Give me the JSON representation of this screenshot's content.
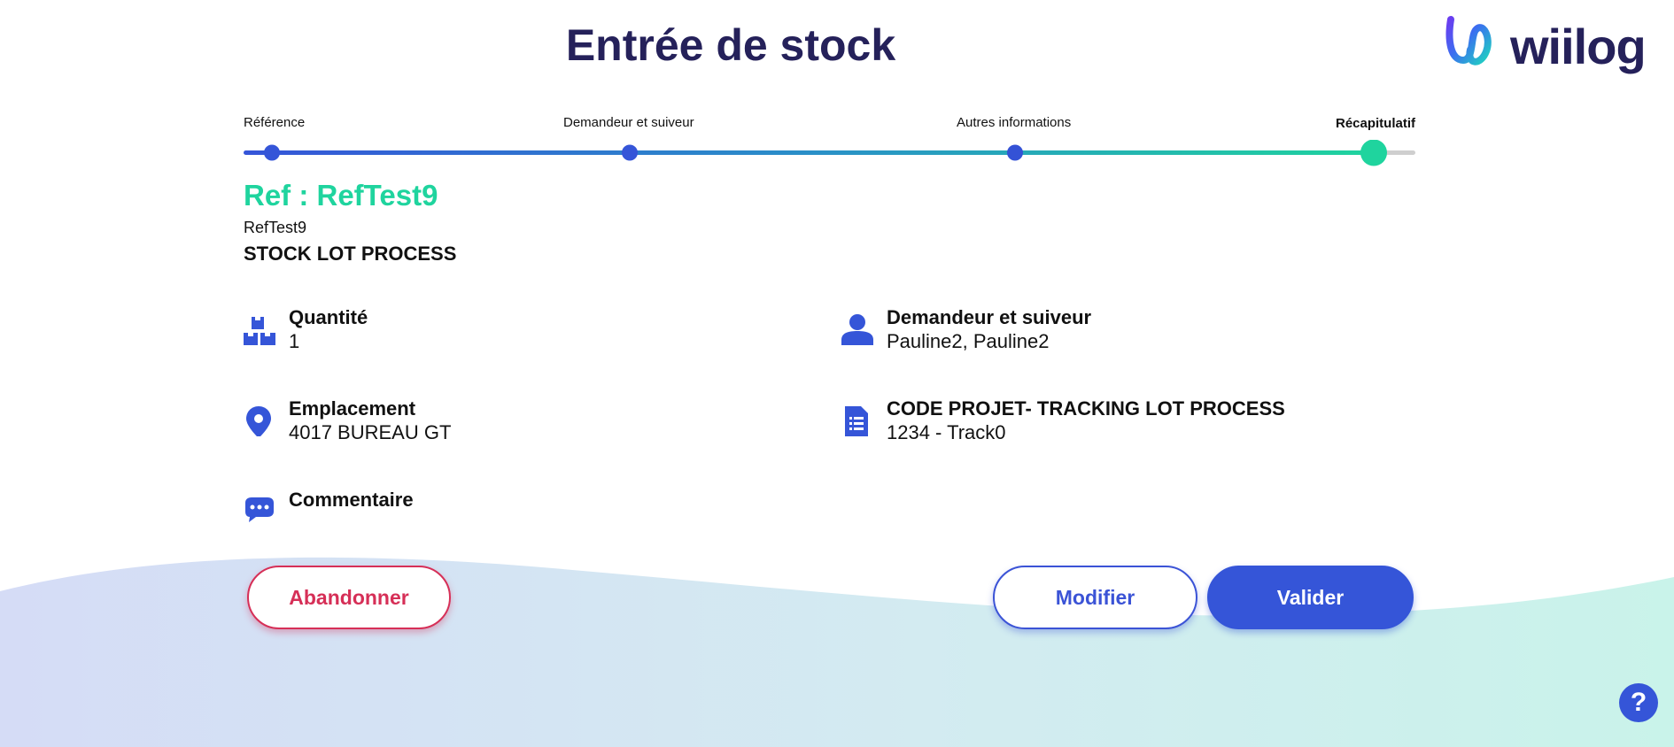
{
  "header": {
    "title": "Entrée de stock",
    "logo_text": "wiilog"
  },
  "stepper": {
    "steps": [
      {
        "label": "Référence"
      },
      {
        "label": "Demandeur et suiveur"
      },
      {
        "label": "Autres informations"
      },
      {
        "label": "Récapitulatif",
        "active": true
      }
    ]
  },
  "reference": {
    "title": "Ref : RefTest9",
    "code": "RefTest9",
    "description": "STOCK LOT PROCESS"
  },
  "details": {
    "quantity": {
      "label": "Quantité",
      "value": "1",
      "icon": "boxes-icon"
    },
    "requester": {
      "label": "Demandeur et suiveur",
      "value": "Pauline2, Pauline2",
      "icon": "user-icon"
    },
    "location": {
      "label": "Emplacement",
      "value": "4017 BUREAU GT",
      "icon": "location-pin-icon"
    },
    "project": {
      "label": "CODE PROJET- TRACKING LOT PROCESS",
      "value": "1234 - Track0",
      "icon": "document-icon"
    },
    "comment": {
      "label": "Commentaire",
      "icon": "comment-icon"
    }
  },
  "actions": {
    "abandon_label": "Abandonner",
    "modify_label": "Modifier",
    "validate_label": "Valider"
  },
  "help": {
    "label": "?"
  },
  "colors": {
    "primary": "#3555d8",
    "accent": "#1fd49e",
    "danger": "#d62f57",
    "title": "#25215a"
  }
}
